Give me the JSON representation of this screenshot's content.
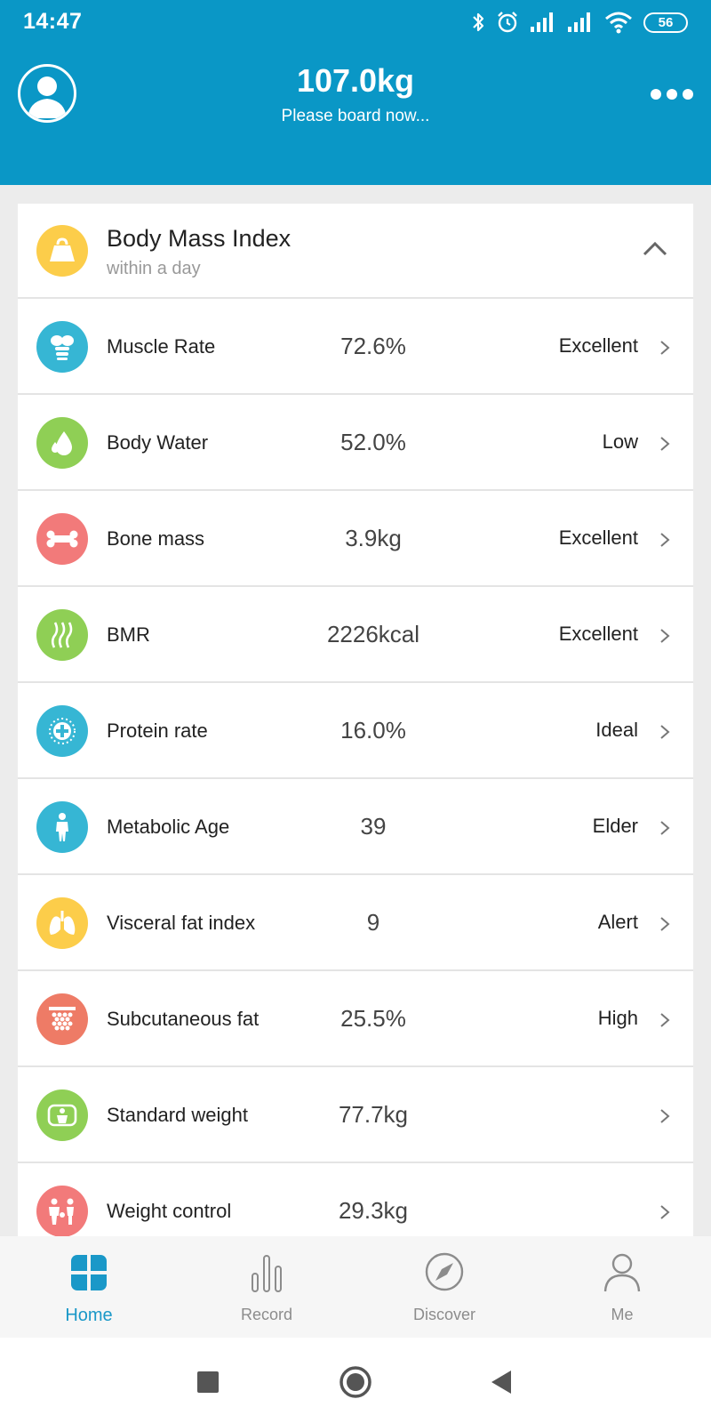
{
  "status_bar": {
    "time": "14:47",
    "battery": "56"
  },
  "header": {
    "weight": "107.0kg",
    "subtitle": "Please board now..."
  },
  "card": {
    "title": "Body Mass Index",
    "subtitle": "within a day"
  },
  "metrics": [
    {
      "label": "Muscle Rate",
      "value": "72.6%",
      "status": "Excellent",
      "icon": "muscle-icon",
      "color": "#36b6d4"
    },
    {
      "label": "Body Water",
      "value": "52.0%",
      "status": "Low",
      "icon": "water-drop-icon",
      "color": "#8fcf55"
    },
    {
      "label": "Bone mass",
      "value": "3.9kg",
      "status": "Excellent",
      "icon": "bone-icon",
      "color": "#f27a7a"
    },
    {
      "label": "BMR",
      "value": "2226kcal",
      "status": "Excellent",
      "icon": "heat-waves-icon",
      "color": "#8fcf55"
    },
    {
      "label": "Protein rate",
      "value": "16.0%",
      "status": "Ideal",
      "icon": "protein-cross-icon",
      "color": "#36b6d4"
    },
    {
      "label": "Metabolic Age",
      "value": "39",
      "status": "Elder",
      "icon": "person-icon",
      "color": "#36b6d4"
    },
    {
      "label": "Visceral fat index",
      "value": "9",
      "status": "Alert",
      "icon": "lungs-icon",
      "color": "#fccd4a"
    },
    {
      "label": "Subcutaneous fat",
      "value": "25.5%",
      "status": "High",
      "icon": "fat-grid-icon",
      "color": "#ee7b66"
    },
    {
      "label": "Standard weight",
      "value": "77.7kg",
      "status": "",
      "icon": "body-scale-icon",
      "color": "#8fcf55"
    },
    {
      "label": "Weight control",
      "value": "29.3kg",
      "status": "",
      "icon": "family-icon",
      "color": "#f27a7a"
    }
  ],
  "tabs": [
    {
      "label": "Home",
      "icon": "home-grid-icon",
      "active": true
    },
    {
      "label": "Record",
      "icon": "bar-chart-icon",
      "active": false
    },
    {
      "label": "Discover",
      "icon": "compass-icon",
      "active": false
    },
    {
      "label": "Me",
      "icon": "user-icon",
      "active": false
    }
  ],
  "colors": {
    "header": "#0a97c6",
    "accent": "#1a98c8",
    "bmi_icon": "#fccd4a"
  }
}
